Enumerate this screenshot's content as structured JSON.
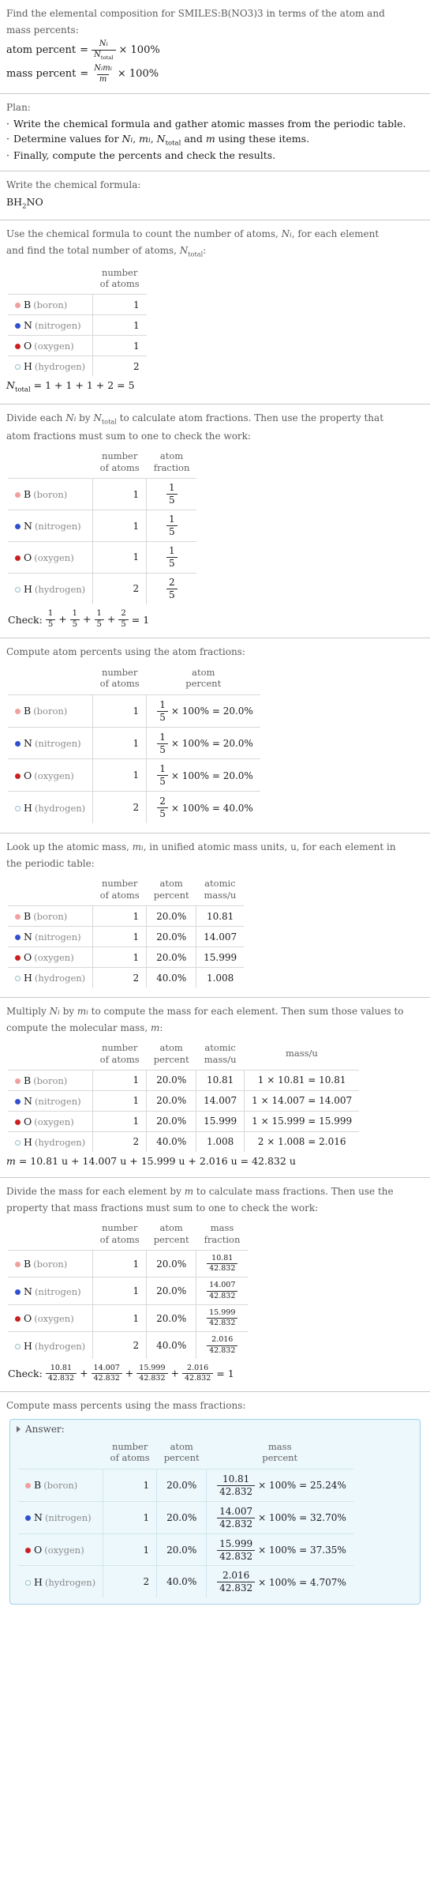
{
  "question": {
    "line1": "Find the elemental composition for SMILES:B(NO3)3 in terms of the atom and",
    "line2": "mass percents:",
    "atom_percent_label": "atom percent",
    "mass_percent_label": "mass percent",
    "equals": "=",
    "times100": "× 100%",
    "N_i": "N",
    "i": "i",
    "N_total_base": "N",
    "total_sub": "total",
    "m_i_m": "m",
    "m": "m"
  },
  "plan": {
    "heading": "Plan:",
    "items": [
      "Write the chemical formula and gather atomic masses from the periodic table.",
      "Determine values for Nᵢ, mᵢ, Nₜₒₜₐₗ and m using these items.",
      "Finally, compute the percents and check the results."
    ],
    "item2_parts": {
      "pre": "Determine values for ",
      "post": " using these items."
    }
  },
  "step_formula": {
    "prompt": "Write the chemical formula:",
    "formula_pre": "BH",
    "formula_sub": "2",
    "formula_post": "NO"
  },
  "step_count": {
    "prompt_line1": "Use the chemical formula to count the number of atoms, Nᵢ, for each element",
    "prompt_line2": "and find the total number of atoms, Nₜₒₜₐₗ:",
    "header_number_of_atoms": "number\nof atoms",
    "header_l1": "number",
    "header_l2": "of atoms",
    "total_line": "N",
    "total_sub": "total",
    "total_expr": " = 1 + 1 + 1 + 2 = 5"
  },
  "step_fraction": {
    "prompt_line1": "Divide each Nᵢ by Nₜₒₜₐₗ to calculate atom fractions. Then use the property that",
    "prompt_line2": "atom fractions must sum to one to check the work:",
    "header_atoms_l1": "number",
    "header_atoms_l2": "of atoms",
    "header_frac_l1": "atom",
    "header_frac_l2": "fraction",
    "check_label": "Check:",
    "check_result": "= 1"
  },
  "step_atom_percent": {
    "prompt": "Compute atom percents using the atom fractions:",
    "header_atoms_l1": "number",
    "header_atoms_l2": "of atoms",
    "header_pct_l1": "atom",
    "header_pct_l2": "percent"
  },
  "step_atomic_mass": {
    "prompt_line1": "Look up the atomic mass, mᵢ, in unified atomic mass units, u, for each element in",
    "prompt_line2": "the periodic table:",
    "header_atoms_l1": "number",
    "header_atoms_l2": "of atoms",
    "header_pct_l1": "atom",
    "header_pct_l2": "percent",
    "header_mass_l1": "atomic",
    "header_mass_l2": "mass/u"
  },
  "step_mass": {
    "prompt_line1": "Multiply Nᵢ by mᵢ to compute the mass for each element. Then sum those values to",
    "prompt_line2": "compute the molecular mass, m:",
    "header_atoms_l1": "number",
    "header_atoms_l2": "of atoms",
    "header_pct_l1": "atom",
    "header_pct_l2": "percent",
    "header_amass_l1": "atomic",
    "header_amass_l2": "mass/u",
    "header_mass": "mass/u",
    "total_prefix": "m",
    "total_expr": " = 10.81 u + 14.007 u + 15.999 u + 2.016 u = 42.832 u"
  },
  "step_mass_fraction": {
    "prompt_line1": "Divide the mass for each element by m to calculate mass fractions. Then use the",
    "prompt_line2": "property that mass fractions must sum to one to check the work:",
    "header_atoms_l1": "number",
    "header_atoms_l2": "of atoms",
    "header_pct_l1": "atom",
    "header_pct_l2": "percent",
    "header_frac_l1": "mass",
    "header_frac_l2": "fraction",
    "check_label": "Check:",
    "check_result": "= 1"
  },
  "step_mass_percent": {
    "prompt": "Compute mass percents using the mass fractions:",
    "answer_label": "Answer:",
    "header_atoms_l1": "number",
    "header_atoms_l2": "of atoms",
    "header_pct_l1": "atom",
    "header_pct_l2": "percent",
    "header_mpct_l1": "mass",
    "header_mpct_l2": "percent"
  },
  "elements": [
    {
      "symbol": "B",
      "name": "(boron)",
      "color": "#f0a0a0",
      "filled": true,
      "atoms": "1",
      "atom_fraction_num": "1",
      "atom_fraction_den": "5",
      "atom_percent": "20.0%",
      "atomic_mass": "10.81",
      "mass_expr": "1 × 10.81 = 10.81",
      "mass_num": "10.81",
      "mass_den": "42.832",
      "mass_percent": "25.24%"
    },
    {
      "symbol": "N",
      "name": "(nitrogen)",
      "color": "#3050d0",
      "filled": true,
      "atoms": "1",
      "atom_fraction_num": "1",
      "atom_fraction_den": "5",
      "atom_percent": "20.0%",
      "atomic_mass": "14.007",
      "mass_expr": "1 × 14.007 = 14.007",
      "mass_num": "14.007",
      "mass_den": "42.832",
      "mass_percent": "32.70%"
    },
    {
      "symbol": "O",
      "name": "(oxygen)",
      "color": "#cc2020",
      "filled": true,
      "atoms": "1",
      "atom_fraction_num": "1",
      "atom_fraction_den": "5",
      "atom_percent": "20.0%",
      "atomic_mass": "15.999",
      "mass_expr": "1 × 15.999 = 15.999",
      "mass_num": "15.999",
      "mass_den": "42.832",
      "mass_percent": "37.35%"
    },
    {
      "symbol": "H",
      "name": "(hydrogen)",
      "color": "#ffffff",
      "filled": false,
      "atoms": "2",
      "atom_fraction_num": "2",
      "atom_fraction_den": "5",
      "atom_percent": "40.0%",
      "atomic_mass": "1.008",
      "mass_expr": "2 × 1.008 = 2.016",
      "mass_num": "2.016",
      "mass_den": "42.832",
      "mass_percent": "4.707%"
    }
  ],
  "colors": {
    "rule": "#c9c9c9",
    "grid": "#d8d8d8",
    "prompt_text": "#5a5a5a",
    "answer_bg": "#edf8fc",
    "answer_border": "#9fd2e8"
  }
}
